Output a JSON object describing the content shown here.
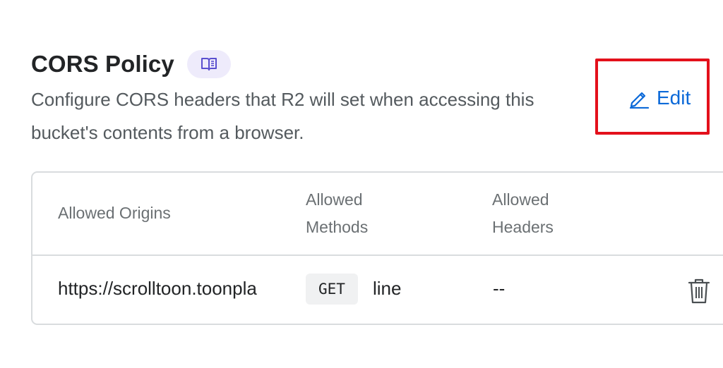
{
  "section": {
    "title": "CORS Policy",
    "docs_icon": "book-open-icon",
    "description": "Configure CORS headers that R2 will set when accessing this bucket's contents from a browser.",
    "edit_label": "Edit",
    "edit_icon": "pencil-icon"
  },
  "table": {
    "columns": [
      "Allowed Origins",
      "Allowed Methods",
      "Allowed Headers"
    ],
    "rows": [
      {
        "origin_visible_start": "https://scrolltoon.toonpla",
        "origin_visible_end": "line",
        "method": "GET",
        "headers": "--",
        "delete_icon": "trash-icon"
      }
    ]
  },
  "colors": {
    "accent": "#0b69d8",
    "highlight": "#e3101b",
    "badge_bg": "#eeebfb",
    "badge_icon": "#5a4fcf",
    "border": "#d9dcde"
  }
}
